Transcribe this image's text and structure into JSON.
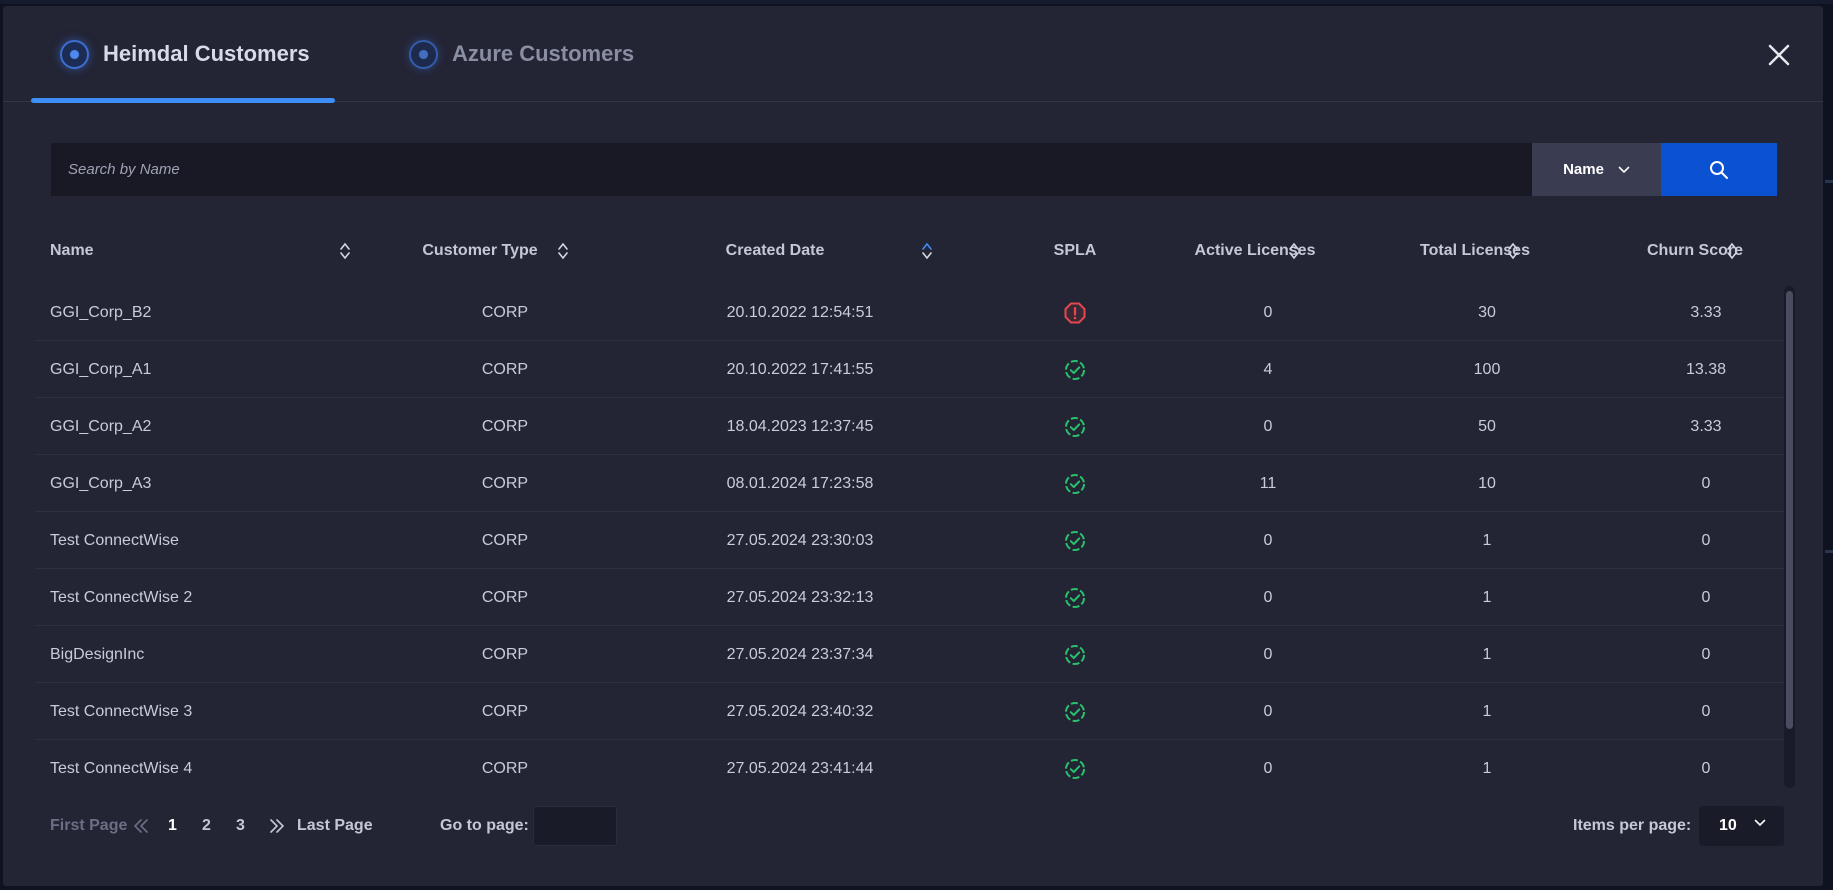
{
  "tabs": [
    {
      "label": "Heimdal Customers",
      "active": true
    },
    {
      "label": "Azure Customers",
      "active": false
    }
  ],
  "search": {
    "placeholder": "Search by Name",
    "value": "",
    "field_selected": "Name",
    "button_icon": "search-icon"
  },
  "table": {
    "columns": [
      "Name",
      "Customer Type",
      "Created Date",
      "SPLA",
      "Active Licenses",
      "Total Licenses",
      "Churn Score"
    ],
    "rows": [
      {
        "name": "GGI_Corp_B2",
        "type": "CORP",
        "date": "20.10.2022  12:54:51",
        "spla": "warning",
        "active": "0",
        "total": "30",
        "churn": "3.33"
      },
      {
        "name": "GGI_Corp_A1",
        "type": "CORP",
        "date": "20.10.2022  17:41:55",
        "spla": "ok",
        "active": "4",
        "total": "100",
        "churn": "13.38"
      },
      {
        "name": "GGI_Corp_A2",
        "type": "CORP",
        "date": "18.04.2023  12:37:45",
        "spla": "ok",
        "active": "0",
        "total": "50",
        "churn": "3.33"
      },
      {
        "name": "GGI_Corp_A3",
        "type": "CORP",
        "date": "08.01.2024  17:23:58",
        "spla": "ok",
        "active": "11",
        "total": "10",
        "churn": "0"
      },
      {
        "name": "Test ConnectWise",
        "type": "CORP",
        "date": "27.05.2024  23:30:03",
        "spla": "ok",
        "active": "0",
        "total": "1",
        "churn": "0"
      },
      {
        "name": "Test ConnectWise 2",
        "type": "CORP",
        "date": "27.05.2024  23:32:13",
        "spla": "ok",
        "active": "0",
        "total": "1",
        "churn": "0"
      },
      {
        "name": "BigDesignInc",
        "type": "CORP",
        "date": "27.05.2024  23:37:34",
        "spla": "ok",
        "active": "0",
        "total": "1",
        "churn": "0"
      },
      {
        "name": "Test ConnectWise 3",
        "type": "CORP",
        "date": "27.05.2024  23:40:32",
        "spla": "ok",
        "active": "0",
        "total": "1",
        "churn": "0"
      },
      {
        "name": "Test ConnectWise 4",
        "type": "CORP",
        "date": "27.05.2024  23:41:44",
        "spla": "ok",
        "active": "0",
        "total": "1",
        "churn": "0"
      }
    ]
  },
  "pagination": {
    "first_label": "First Page",
    "last_label": "Last Page",
    "pages": [
      "1",
      "2",
      "3"
    ],
    "current_page": "1",
    "goto_label": "Go to page:",
    "goto_value": "",
    "items_per_page_label": "Items per page:",
    "items_per_page_value": "10"
  },
  "colors": {
    "accent": "#3d8ef5",
    "search_button": "#0b52d3",
    "status_ok": "#27c26b",
    "status_warning": "#e5484d"
  }
}
